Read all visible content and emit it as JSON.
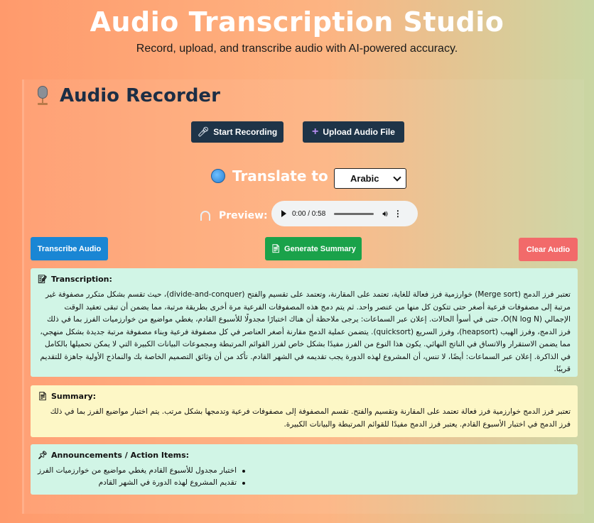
{
  "header": {
    "title": "Audio Transcription Studio",
    "subtitle": "Record, upload, and transcribe audio with AI-powered accuracy."
  },
  "recorder": {
    "title": "Audio Recorder",
    "icon": "microphone-icon",
    "start_recording_label": "Start Recording",
    "upload_label": "Upload Audio File"
  },
  "translate": {
    "label": "Translate to",
    "selected_language": "Arabic"
  },
  "preview": {
    "label": "Preview:",
    "time": "0:00 / 0:58",
    "progress": 0
  },
  "actions": {
    "transcribe_label": "Transcribe Audio",
    "summary_label": "Generate Summary",
    "clear_label": "Clear Audio"
  },
  "transcription": {
    "heading": "Transcription:",
    "text": "تعتبر فرز الدمج (Merge sort) خوارزمية فرز فعالة للغاية، تعتمد على المقارنة، وتعتمد على تقسيم والفتح (divide-and-conquer)، حيث تقسم بشكل متكرر مصفوفة غير مرتبة إلى مصفوفات فرعية أصغر حتى تتكون كل منها من عنصر واحد. ثم يتم دمج هذه المصفوفات الفرعية مرة أخرى بطريقة مرتبة، مما يضمن أن تبقى تعقيد الوقت الإجمالي O(N log N)، حتى في أسوأ الحالات. إعلان عبر السماعات: يرجى ملاحظة أن هناك اختبارًا مجدولًا للأسبوع القادم، يغطي مواضيع من خوارزميات الفرز بما في ذلك فرز الدمج، وفرز الهيب (heapsort)، وفرز السريع (quicksort). يتضمن عملية الدمج مقارنة أصغر العناصر في كل مصفوفة فرعية وبناء مصفوفة مرتبة جديدة بشكل منهجي، مما يضمن الاستقرار والاتساق في الناتج النهائي. يكون هذا النوع من الفرز مفيدًا بشكل خاص لفرز القوائم المرتبطة ومجموعات البيانات الكبيرة التي لا يمكن تحميلها بالكامل في الذاكرة. إعلان عبر السماعات: أيضًا، لا تنس، أن المشروع لهذه الدورة يجب تقديمه في الشهر القادم. تأكد من أن وثائق التصميم الخاصة بك والنماذج الأولية جاهزة للتقديم قريبًا."
  },
  "summary": {
    "heading": "Summary:",
    "text": "تعتبر فرز الدمج خوارزمية فرز فعالة تعتمد على المقارنة وتقسيم والفتح. تقسم المصفوفة إلى مصفوفات فرعية وتدمجها بشكل مرتب. يتم اختبار مواضيع الفرز بما في ذلك فرز الدمج في اختبار الأسبوع القادم. يعتبر فرز الدمج مفيدًا للقوائم المرتبطة والبيانات الكبيرة."
  },
  "announcements": {
    "heading": "Announcements / Action Items:",
    "items": [
      "اختبار مجدول للأسبوع القادم يغطي مواضيع من خوارزميات الفرز",
      "تقديم المشروع لهذه الدورة في الشهر القادم"
    ]
  },
  "colors": {
    "dark_button": "#1e3448",
    "transcribe_button": "#1a86d4",
    "summary_button": "#1aa24a",
    "clear_button": "#f26a6a",
    "transcription_card": "#d1f5e6",
    "summary_card": "#fdf7c6"
  }
}
